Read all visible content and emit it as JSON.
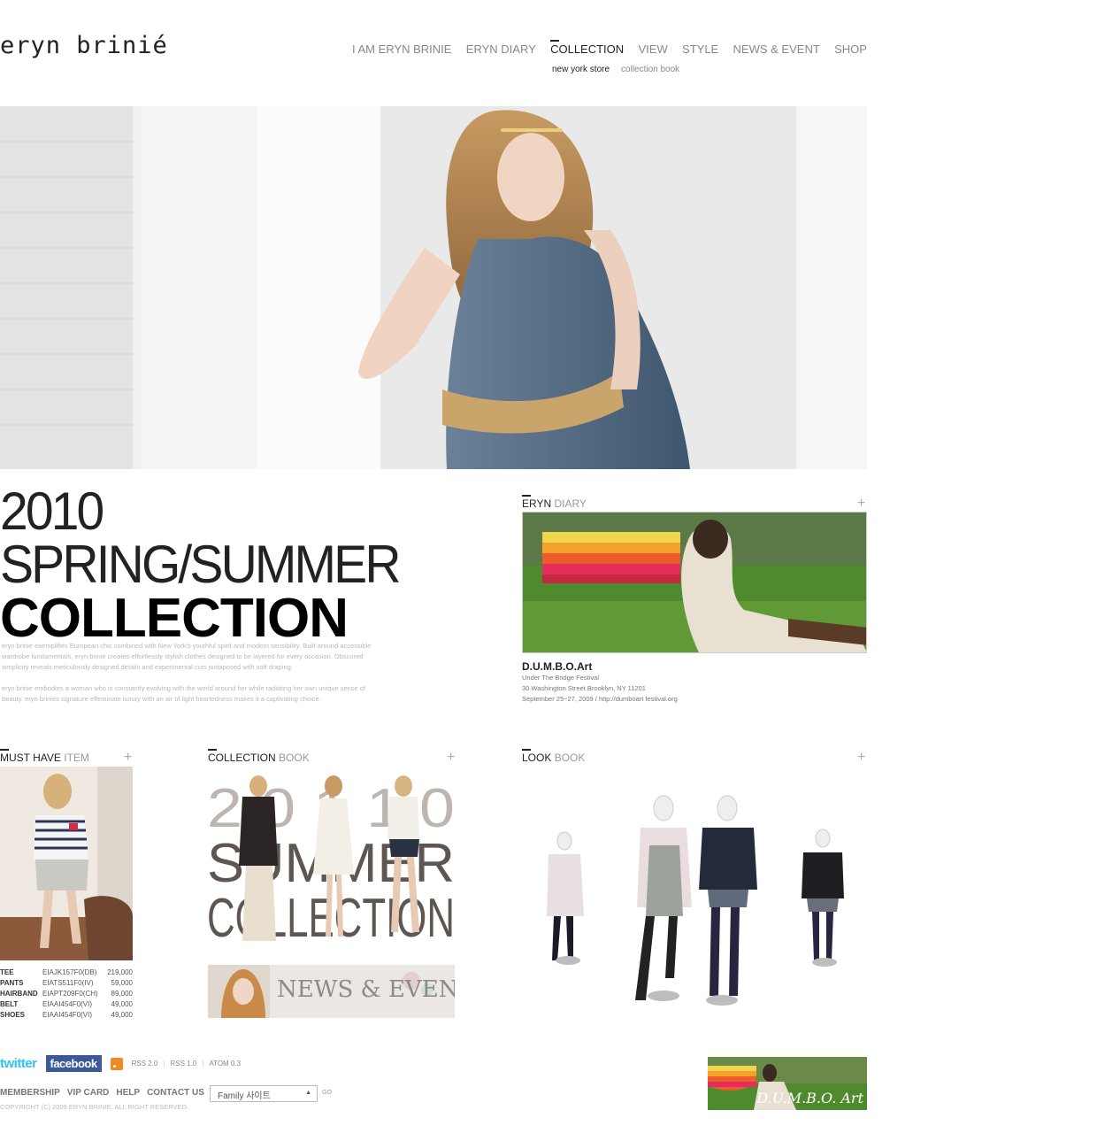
{
  "brand": {
    "logo": "eryn brinié"
  },
  "nav": {
    "items": [
      {
        "label": "I  AM ERYN BRINIE"
      },
      {
        "label": "ERYN DIARY"
      },
      {
        "label": "COLLECTION"
      },
      {
        "label": "VIEW"
      },
      {
        "label": "STYLE"
      },
      {
        "label": "NEWS & EVENT"
      },
      {
        "label": "SHOP"
      }
    ],
    "active": "COLLECTION",
    "subnav": [
      {
        "label": "new york store",
        "selected": true
      },
      {
        "label": "collection book",
        "selected": false
      }
    ]
  },
  "headline": {
    "year": "2010",
    "season": "SPRING/SUMMER",
    "collection": "COLLECTION",
    "paragraphs": [
      "eryn brinie exemplifies European chic combined with New York's youthful spirit and modern sensibility. Built around accessible wardrobe fundamentals, eryn brinie creates effortlessly stylish clothes designed to be layered for every occasion. Obscured simplicity reveals meticulously designed details and experimental cuts juxtaposed with soft draping.",
      "eryn brinie embodies a woman who is constantly evolving with the world around her while radiating her own unique sense of beauty. eryn brinies signature effeminate luxury with an air of light heartedness makes it a captivating choice."
    ]
  },
  "diary": {
    "title_bold": "ERYN",
    "title_light": " DIARY",
    "plus": "+",
    "post_title": "D.U.M.B.O.Art",
    "line1": "Under The Bridge Festival",
    "line2": "30 Washington Street Brooklyn, NY 11201",
    "line3": "September 25~27, 2009 / http://dumboart festival.org"
  },
  "must_have": {
    "title_bold": "MUST HAVE",
    "title_light": " ITEM",
    "plus": "+",
    "items": [
      {
        "name": "TEE",
        "code": "EIAJK157F0(DB)",
        "price": "219,000"
      },
      {
        "name": "PANTS",
        "code": "EIATS511F0(IV)",
        "price": "59,000"
      },
      {
        "name": "HAIRBAND",
        "code": "EIAPT209F0(CH)",
        "price": "89,000"
      },
      {
        "name": "BELT",
        "code": "EIAAI454F0(VI)",
        "price": "49,000"
      },
      {
        "name": "SHOES",
        "code": "EIAAI454F0(VI)",
        "price": "49,000"
      }
    ]
  },
  "collection_book": {
    "title_bold": "COLLECTION",
    "title_light": " BOOK",
    "plus": "+",
    "news_banner": "NEWS & EVENT"
  },
  "look_book": {
    "title_bold": "LOOK",
    "title_light": " BOOK",
    "plus": "+"
  },
  "social": {
    "twitter": "twitter",
    "facebook": "facebook",
    "feeds": [
      "RSS 2.0",
      "RSS 1.0",
      "ATOM 0.3"
    ]
  },
  "footer": {
    "links": [
      "MEMBERSHIP",
      "VIP CARD",
      "HELP",
      "CONTACT US"
    ],
    "family_select": "Family 사이트",
    "go": "GO",
    "copyright": "COPYRIGHT (C) 2009 ERYN BRINIE. ALL RIGHT RESERVED.",
    "banner_caption": "D.U.M.B.O. Art"
  },
  "colors": {
    "twitter": "#33c1f0",
    "facebook": "#3b5998",
    "rss": "#f08a24"
  }
}
